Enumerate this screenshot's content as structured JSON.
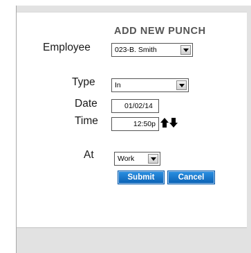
{
  "form": {
    "title": "ADD NEW PUNCH",
    "employee": {
      "label": "Employee",
      "value": "023-B. Smith"
    },
    "type": {
      "label": "Type",
      "value": "In"
    },
    "date": {
      "label": "Date",
      "value": "01/02/14"
    },
    "time": {
      "label": "Time",
      "value": "12:50p"
    },
    "at": {
      "label": "At",
      "value": "Work"
    },
    "submit_label": "Submit",
    "cancel_label": "Cancel"
  },
  "icons": {
    "time_up": "arrow-up-icon",
    "time_down": "arrow-down-icon"
  },
  "colors": {
    "button": "#1479cc",
    "heading": "#555555"
  }
}
